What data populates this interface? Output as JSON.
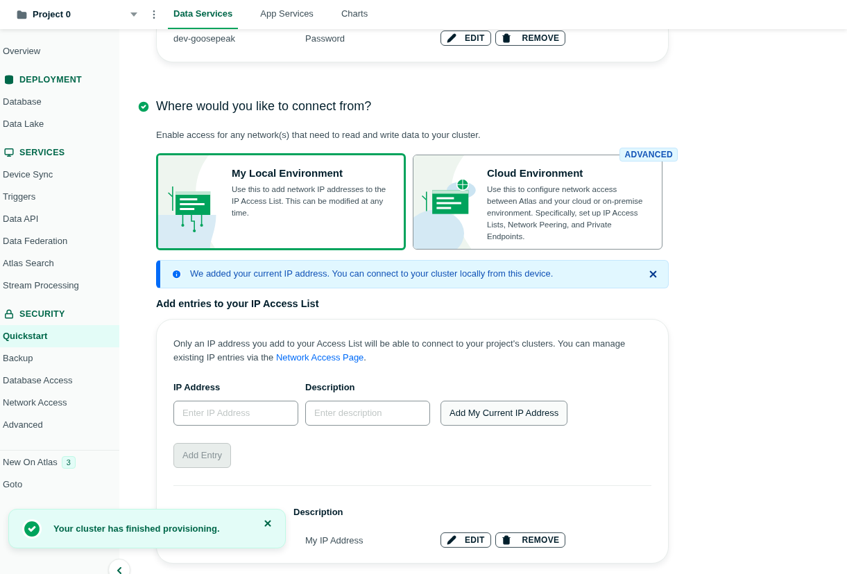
{
  "top_bar": {
    "project": "Project 0",
    "tabs": [
      {
        "label": "Data Services",
        "selected": true
      },
      {
        "label": "App Services",
        "selected": false
      },
      {
        "label": "Charts",
        "selected": false
      }
    ]
  },
  "sidebar": {
    "items": [
      {
        "kind": "link",
        "label": "Overview",
        "selected": false
      },
      {
        "kind": "header",
        "label": "DEPLOYMENT"
      },
      {
        "kind": "link",
        "label": "Database",
        "selected": false
      },
      {
        "kind": "link",
        "label": "Data Lake",
        "selected": false
      },
      {
        "kind": "header",
        "label": "SERVICES"
      },
      {
        "kind": "link",
        "label": "Device Sync",
        "selected": false
      },
      {
        "kind": "link",
        "label": "Triggers",
        "selected": false
      },
      {
        "kind": "link",
        "label": "Data API",
        "selected": false
      },
      {
        "kind": "link",
        "label": "Data Federation",
        "selected": false
      },
      {
        "kind": "link",
        "label": "Atlas Search",
        "selected": false
      },
      {
        "kind": "link",
        "label": "Stream Processing",
        "selected": false
      },
      {
        "kind": "header",
        "label": "SECURITY"
      },
      {
        "kind": "link",
        "label": "Quickstart",
        "selected": true
      },
      {
        "kind": "link",
        "label": "Backup",
        "selected": false
      },
      {
        "kind": "link",
        "label": "Database Access",
        "selected": false
      },
      {
        "kind": "link",
        "label": "Network Access",
        "selected": false
      },
      {
        "kind": "link",
        "label": "Advanced",
        "selected": false
      }
    ],
    "footer_items": [
      {
        "label": "New On Atlas",
        "badge": "3"
      },
      {
        "label": "Goto"
      }
    ]
  },
  "user_row": {
    "username": "dev-goosepeak",
    "auth": "Password",
    "edit": "EDIT",
    "remove": "REMOVE"
  },
  "connect": {
    "title": "Where would you like to connect from?",
    "done": true,
    "description": "Enable access for any network(s) that need to read and write data to your cluster.",
    "options": [
      {
        "title": "My Local Environment",
        "description": "Use this to add network IP addresses to the IP Access List. This can be modified at any time.",
        "selected": true
      },
      {
        "title": "Cloud Environment",
        "description": "Use this to configure network access between Atlas and your cloud or on-premise environment. Specifically, set up IP Access Lists, Network Peering, and Private Endpoints.",
        "selected": false,
        "badge": "ADVANCED"
      }
    ]
  },
  "alert": {
    "text": "We added your current IP address. You can connect to your cluster locally from this device."
  },
  "ip_access": {
    "title": "Add entries to your IP Access List",
    "intro_before": "Only an IP address you add to your Access List will be able to connect to your project's clusters. You can manage existing IP entries via the ",
    "intro_link": "Network Access Page",
    "intro_after": ".",
    "fields": [
      {
        "label": "IP Address",
        "placeholder": "Enter IP Address"
      },
      {
        "label": "Description",
        "placeholder": "Enter description"
      }
    ],
    "add_current": "Add My Current IP Address",
    "add_entry": {
      "label": "Add Entry",
      "disabled": true
    },
    "columns": [
      "Description"
    ],
    "rows": [
      {
        "description": "My IP Address",
        "edit": "EDIT",
        "remove": "REMOVE"
      }
    ]
  },
  "toast": {
    "text": "Your cluster has finished provisioning."
  }
}
